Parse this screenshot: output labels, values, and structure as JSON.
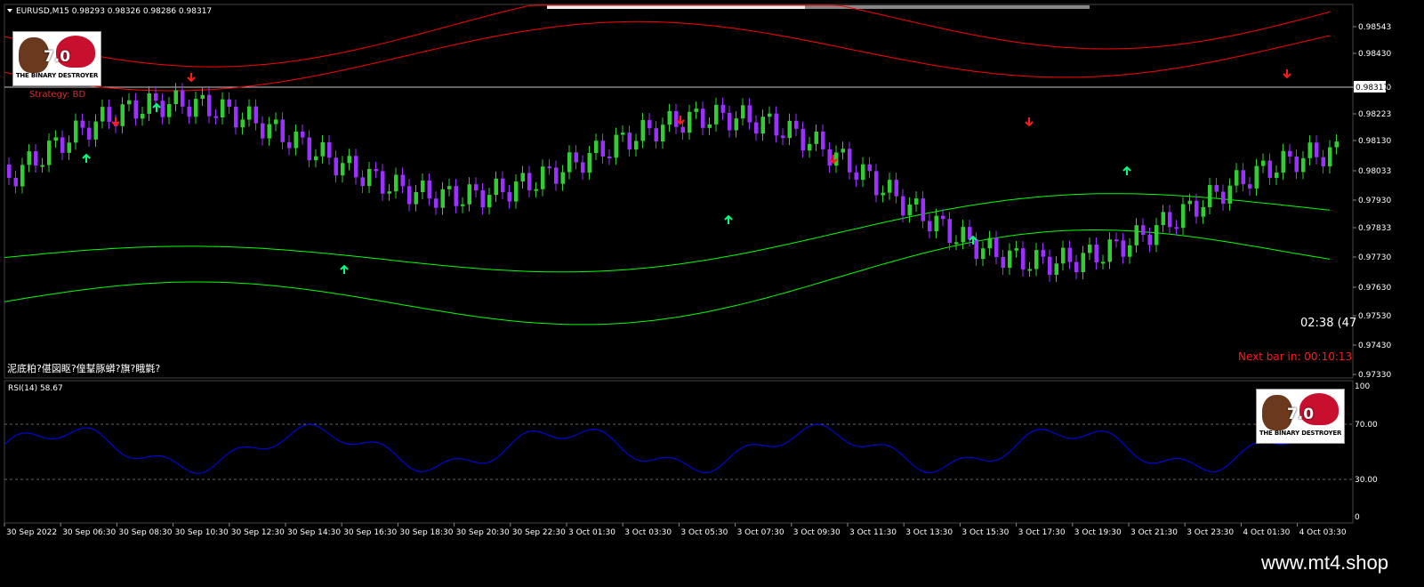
{
  "header": {
    "symbol_line": "EURUSD,M15  0.98293 0.98326 0.98286 0.98317"
  },
  "strategy_label": "Strategy: BD",
  "garbled_text": "泥底粕?偡図眍?偟鞤豚蟒?旗?睋氋?",
  "countdown": "02:38 (47",
  "next_bar": "Next bar in: 00:10:13",
  "logo": {
    "version": "7.0",
    "brand": "THE BINARY DESTROYER"
  },
  "price_axis": {
    "ticks": [
      "0.98543",
      "0.98430",
      "0.98340",
      "0.98223",
      "0.98130",
      "0.98033",
      "0.97930",
      "0.97833",
      "0.97730",
      "0.97630",
      "0.97530",
      "0.97430",
      "0.97330"
    ],
    "current_price": "0.98317"
  },
  "rsi": {
    "label": "RSI(14) 58.67",
    "ticks": [
      "100",
      "70.00",
      "30.00",
      "0"
    ]
  },
  "time_axis": [
    "30 Sep 2022",
    "30 Sep 06:30",
    "30 Sep 08:30",
    "30 Sep 10:30",
    "30 Sep 12:30",
    "30 Sep 14:30",
    "30 Sep 16:30",
    "30 Sep 18:30",
    "30 Sep 20:30",
    "30 Sep 22:30",
    "3 Oct 01:30",
    "3 Oct 03:30",
    "3 Oct 05:30",
    "3 Oct 07:30",
    "3 Oct 09:30",
    "3 Oct 11:30",
    "3 Oct 13:30",
    "3 Oct 15:30",
    "3 Oct 17:30",
    "3 Oct 19:30",
    "3 Oct 21:30",
    "3 Oct 23:30",
    "4 Oct 01:30",
    "4 Oct 03:30"
  ],
  "colors": {
    "background": "#000000",
    "bull_candle": "#32cd32",
    "bear_candle": "#9b30ff",
    "red_band": "#ff0000",
    "green_band": "#00ff00",
    "rsi_line": "#0000ff",
    "text": "#ffffff"
  },
  "footer": {
    "url": "www.mt4.shop"
  }
}
